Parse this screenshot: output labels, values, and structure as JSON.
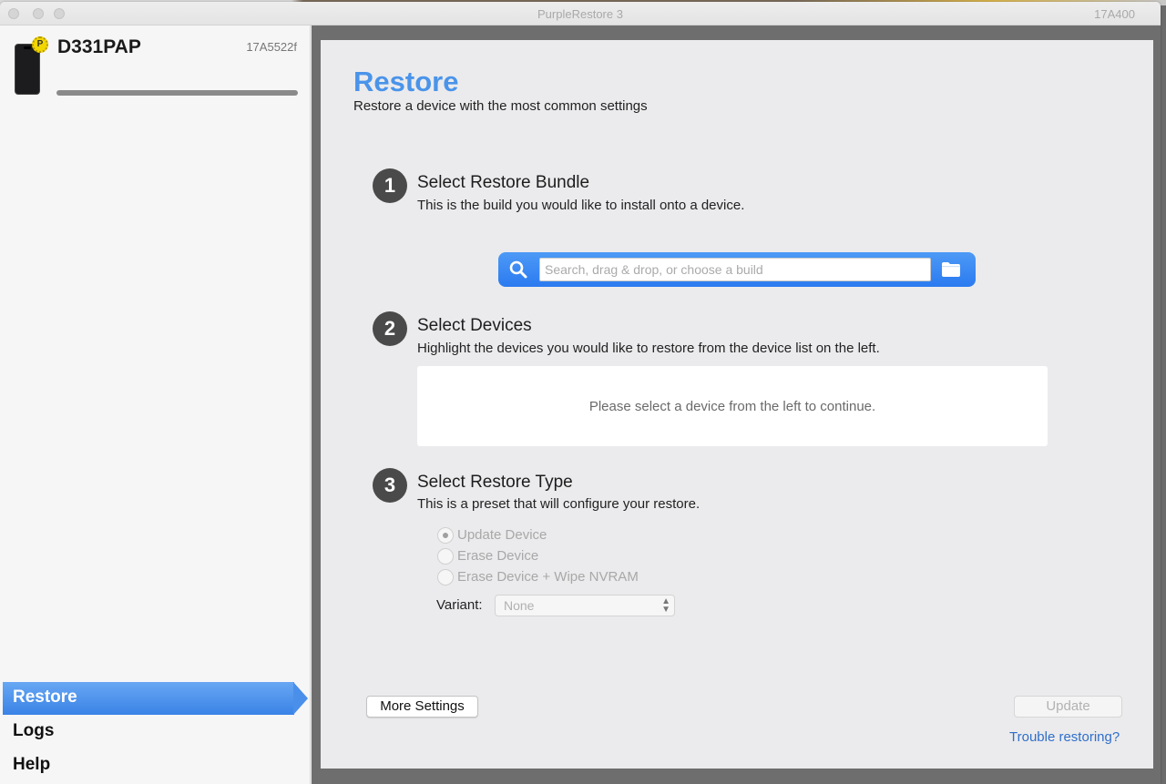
{
  "window": {
    "title": "PurpleRestore 3",
    "build": "17A400"
  },
  "device": {
    "name": "D331PAP",
    "build": "17A5522f",
    "badge": "P",
    "progress": 1.0
  },
  "nav": {
    "restore": "Restore",
    "logs": "Logs",
    "help": "Help",
    "active": "restore"
  },
  "main": {
    "title": "Restore",
    "subtitle": "Restore a device with the most common settings",
    "steps": [
      {
        "number": "1",
        "title": "Select Restore Bundle",
        "desc": "This is the build you would like to install onto a device."
      },
      {
        "number": "2",
        "title": "Select Devices",
        "desc": "Highlight the devices you would like to restore from the device list on the left."
      },
      {
        "number": "3",
        "title": "Select Restore Type",
        "desc": "This is a preset that will configure your restore."
      }
    ],
    "search": {
      "placeholder": "Search, drag & drop, or choose a build",
      "value": ""
    },
    "device_box_msg": "Please select a device from the left to continue.",
    "restore_types": [
      {
        "label": "Update Device",
        "selected": true
      },
      {
        "label": "Erase Device",
        "selected": false
      },
      {
        "label": "Erase Device + Wipe NVRAM",
        "selected": false
      }
    ],
    "variant": {
      "label": "Variant:",
      "value": "None"
    },
    "buttons": {
      "more_settings": "More Settings",
      "update": "Update"
    },
    "trouble_link": "Trouble restoring?"
  },
  "colors": {
    "accent": "#4a94ea",
    "nav_active": "#3a83e6",
    "link": "#2f6fc9"
  },
  "icons": {
    "search": "search-icon",
    "folder": "folder-icon",
    "phone": "phone-icon",
    "badge": "beta-badge-icon"
  }
}
